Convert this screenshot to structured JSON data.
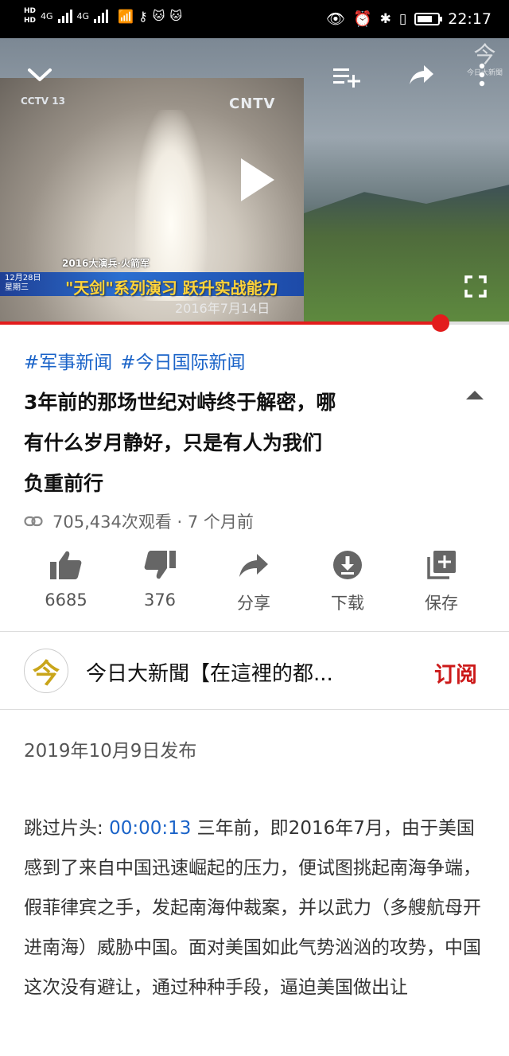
{
  "status_bar": {
    "left_labels": [
      "HD",
      "HD",
      "4G",
      "4G"
    ],
    "time": "22:17",
    "icons": [
      "eye-icon",
      "alarm-icon",
      "bluetooth-icon",
      "vibrate-icon",
      "battery-icon"
    ]
  },
  "video": {
    "overlay_text": {
      "cctv_logo": "CCTV 13",
      "cntv_logo": "CNTV",
      "caption_small": "2016大演兵·火箭军",
      "caption_date_line1": "12月28日",
      "caption_date_line2": "星期三",
      "caption_main": "\"天剑\"系列演习 跃升实战能力",
      "bottom_date": "2016年7月14日",
      "watermark": "今日大新聞"
    },
    "controls": {
      "minimize": "chevron-down-icon",
      "add_to_queue": "playlist-add-icon",
      "share": "share-icon",
      "more": "more-vertical-icon",
      "play": "play-icon",
      "fullscreen": "fullscreen-icon"
    },
    "progress": 0.865
  },
  "tags": [
    "#军事新闻",
    "#今日国际新闻"
  ],
  "title_lines": [
    "3年前的那场世纪对峙终于解密，哪",
    "有什么岁月静好，只是有人为我们",
    "负重前行"
  ],
  "meta": {
    "icon": "link-icon",
    "text": "705,434次观看 · 7 个月前"
  },
  "actions": [
    {
      "icon": "thumb-up-icon",
      "label": "6685"
    },
    {
      "icon": "thumb-down-icon",
      "label": "376"
    },
    {
      "icon": "share-icon",
      "label": "分享"
    },
    {
      "icon": "download-icon",
      "label": "下载"
    },
    {
      "icon": "save-playlist-icon",
      "label": "保存"
    }
  ],
  "channel": {
    "avatar_glyph": "今",
    "name": "今日大新聞【在這裡的都...",
    "subscribe_label": "订阅"
  },
  "description": {
    "published": "2019年10月9日发布",
    "lead": "跳过片头: ",
    "timestamp": "00:00:13",
    "body": " 三年前，即2016年7月，由于美国感到了来自中国迅速崛起的压力，便试图挑起南海争端，假菲律宾之手，发起南海仲裁案，并以武力（多艘航母开进南海）威胁中国。面对美国如此气势汹汹的攻势，中国这次没有避让，通过种种手段，逼迫美国做出让"
  },
  "colors": {
    "link_blue": "#1a63c8",
    "progress_red": "#e31c1c",
    "subscribe_red": "#cc1a1a"
  }
}
